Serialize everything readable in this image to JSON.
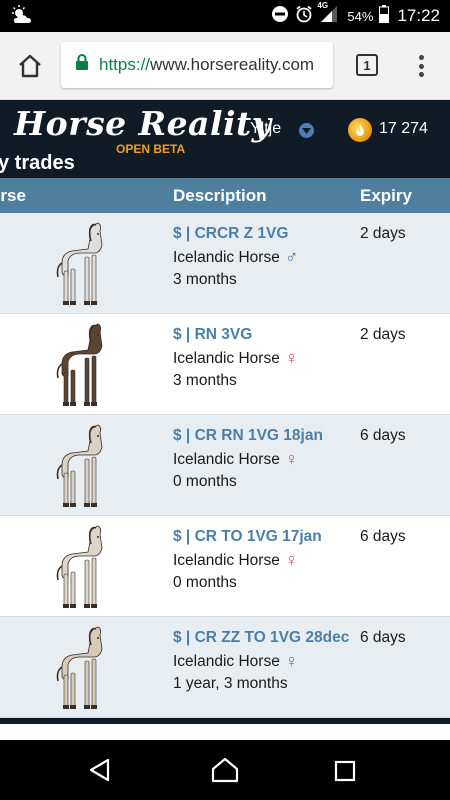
{
  "status_bar": {
    "network": "4G",
    "battery": "54%",
    "time": "17:22"
  },
  "browser": {
    "url_scheme": "https://",
    "url_rest": "www.horsereality.com",
    "tab_count": "1"
  },
  "site": {
    "logo_text": "Horse Reality",
    "logo_badge": "OPEN BETA",
    "username": "Yltje",
    "coins": "17 274",
    "heading": "y trades"
  },
  "table": {
    "columns": [
      "orse",
      "Description",
      "Expiry"
    ],
    "rows": [
      {
        "name": "$ | CRCR Z 1VG",
        "breed": "Icelandic Horse",
        "sex": "male",
        "sex_symbol": "♂",
        "age": "3 months",
        "expiry": "2 days",
        "coat": "#dedede"
      },
      {
        "name": "$ | RN 3VG",
        "breed": "Icelandic Horse",
        "sex": "female",
        "sex_symbol": "♀",
        "age": "3 months",
        "expiry": "2 days",
        "coat": "#5a4433"
      },
      {
        "name": "$ | CR RN 1VG 18jan",
        "breed": "Icelandic Horse",
        "sex": "female",
        "sex_symbol": "♀",
        "age": "0 months",
        "expiry": "6 days",
        "coat": "#d8d2c6"
      },
      {
        "name": "$ | CR TO 1VG 17jan",
        "breed": "Icelandic Horse",
        "sex": "female",
        "sex_symbol": "♀",
        "age": "0 months",
        "expiry": "6 days",
        "coat": "#dcd6ca"
      },
      {
        "name": "$ | CR ZZ TO 1VG 28dec",
        "breed": "Icelandic Horse",
        "sex": "female",
        "sex_symbol": "♀",
        "age": "1 year, 3 months",
        "expiry": "6 days",
        "coat": "#d6cbb6"
      }
    ]
  },
  "colors": {
    "header_bg": "#101b25",
    "table_header_bg": "#4e7f9e",
    "row_alt_bg": "#e8edf1",
    "link": "#4a7fa8",
    "accent": "#e9a12c"
  }
}
